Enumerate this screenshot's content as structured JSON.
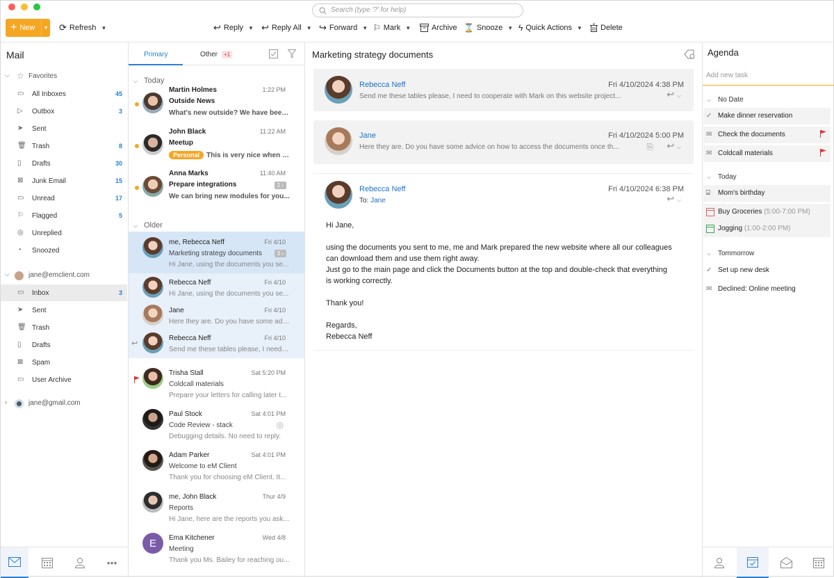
{
  "window": {
    "traffic_lights": [
      "#fe5f57",
      "#febc2e",
      "#28c840"
    ]
  },
  "search": {
    "placeholder": "Search (type '?' for help)"
  },
  "toolbar": {
    "new_label": "New",
    "refresh_label": "Refresh",
    "reply_label": "Reply",
    "reply_all_label": "Reply All",
    "forward_label": "Forward",
    "mark_label": "Mark",
    "archive_label": "Archive",
    "snooze_label": "Snooze",
    "quick_actions_label": "Quick Actions",
    "delete_label": "Delete",
    "accent": "#f5a623"
  },
  "sidebar": {
    "title": "Mail",
    "favorites_label": "Favorites",
    "favorites": [
      {
        "label": "All Inboxes",
        "count": "45"
      },
      {
        "label": "Outbox",
        "count": "3"
      },
      {
        "label": "Sent",
        "count": ""
      },
      {
        "label": "Trash",
        "count": "8"
      },
      {
        "label": "Drafts",
        "count": "30"
      },
      {
        "label": "Junk Email",
        "count": "15"
      },
      {
        "label": "Unread",
        "count": "17"
      },
      {
        "label": "Flagged",
        "count": "5"
      },
      {
        "label": "Unreplied",
        "count": ""
      },
      {
        "label": "Snoozed",
        "count": ""
      }
    ],
    "account1": "jane@emclient.com",
    "account1_folders": [
      {
        "label": "Inbox",
        "count": "3"
      },
      {
        "label": "Sent",
        "count": ""
      },
      {
        "label": "Trash",
        "count": ""
      },
      {
        "label": "Drafts",
        "count": ""
      },
      {
        "label": "Spam",
        "count": ""
      },
      {
        "label": "User Archive",
        "count": ""
      }
    ],
    "account2": "jane@gmail.com"
  },
  "list": {
    "tab_primary": "Primary",
    "tab_other": "Other",
    "tab_other_badge": "+1",
    "group_today": "Today",
    "group_older": "Older",
    "today": [
      {
        "from": "Martin Holmes",
        "date": "1:22 PM",
        "subject": "Outside News",
        "preview": "What's new outside? We have been..."
      },
      {
        "from": "John Black",
        "date": "11:22 AM",
        "subject": "Meetup",
        "tag": "Personal",
        "preview": "This is very nice when y..."
      },
      {
        "from": "Anna Marks",
        "date": "11:40 AM",
        "subject": "Prepare integrations",
        "badge": "2",
        "preview": "We can bring new modules for you..."
      }
    ],
    "older": [
      {
        "from": "me, Rebecca Neff",
        "date": "Fri 4/10",
        "subject": "Marketing strategy documents",
        "badge": "3",
        "preview": "Hi Jane, using the documents you se..."
      },
      {
        "from": "Rebecca Neff",
        "date": "Fri 4/10",
        "preview": "Hi Jane, using the documents you se..."
      },
      {
        "from": "Jane",
        "date": "Fri 4/10",
        "preview": "Here they are. Do you have some adv..."
      },
      {
        "from": "Rebecca Neff",
        "date": "Fri 4/10",
        "preview": "Send me these tables please, I need t..."
      },
      {
        "from": "Trisha Stall",
        "date": "Sat 5:20 PM",
        "subject": "Coldcall materials",
        "preview": "Prepare your letters for calling later t..."
      },
      {
        "from": "Paul Stock",
        "date": "Sat 4:01 PM",
        "subject": "Code Review - stack",
        "preview": "Debugging details. No need to reply."
      },
      {
        "from": "Adam Parker",
        "date": "Sat 4:01 PM",
        "subject": "Welcome to eM Client",
        "preview": "Thank you for choosing eM Client. It..."
      },
      {
        "from": "me, John Black",
        "date": "Thur 4/9",
        "subject": "Reports",
        "preview": "Hi Jane, here are the reports you ask..."
      },
      {
        "from": "Ema Kitchener",
        "date": "Wed 4/8",
        "subject": "Meeting",
        "preview": "Thank you Ms. Bailey for reaching ou...",
        "initial": "E"
      }
    ]
  },
  "reading": {
    "title": "Marketing strategy documents",
    "msg1": {
      "from": "Rebecca Neff",
      "date": "Fri 4/10/2024 4:38 PM",
      "preview": "Send me these tables please, I need to cooperate with Mark on this website project..."
    },
    "msg2": {
      "from": "Jane",
      "date": "Fri 4/10/2024 5:00 PM",
      "preview": "Here they are. Do you have some advice on how to access the documents once th..."
    },
    "msg3": {
      "from": "Rebecca Neff",
      "date": "Fri 4/10/2024 6:38 PM",
      "to_label": "To:",
      "to": "Jane",
      "greeting": "Hi Jane,",
      "para1": "using the documents you sent to me, me and Mark prepared the new website where all our colleagues can download them and use them right away.",
      "para2": "Just go to the main page and click the Documents button at the top and double-check that everything is working correctly.",
      "thanks": "Thank you!",
      "regards": "Regards,",
      "signature": "Rebecca Neff"
    }
  },
  "agenda": {
    "title": "Agenda",
    "add_placeholder": "Add new task",
    "no_date_label": "No Date",
    "no_date": [
      "Make dinner reservation",
      "Check the documents",
      "Coldcall materials"
    ],
    "today_label": "Today",
    "today": [
      {
        "label": "Mom's birthday",
        "time": ""
      },
      {
        "label": "Buy Groceries",
        "time": "(5:00-7:00 PM)"
      },
      {
        "label": "Jogging",
        "time": "(1:00-2:00 PM)"
      }
    ],
    "tomorrow_label": "Tommorrow",
    "tomorrow": [
      "Set up new desk",
      "Declined: Online meeting"
    ]
  }
}
